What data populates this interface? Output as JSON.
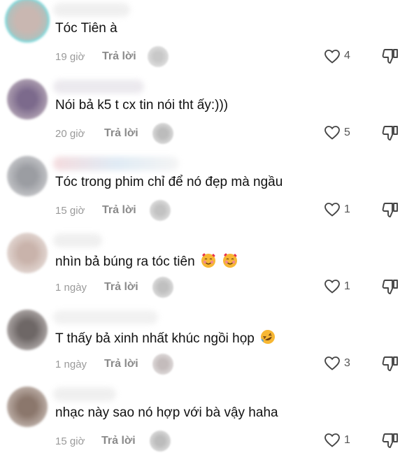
{
  "reply_label": "Trả lời",
  "comments": [
    {
      "text": "Tóc Tiên à",
      "time": "19 giờ",
      "likes": "4",
      "emojis": []
    },
    {
      "text": "Nói bả k5 t cx tin nói tht ấy:)))",
      "time": "20 giờ",
      "likes": "5",
      "emojis": []
    },
    {
      "text": "Tóc trong phim chỉ để nó đẹp mà ngầu",
      "time": "15 giờ",
      "likes": "1",
      "emojis": []
    },
    {
      "text": "nhìn bả búng ra tóc tiên",
      "time": "1 ngày",
      "likes": "1",
      "emojis": [
        "smiling-face-with-hearts",
        "smiling-face-with-hearts"
      ]
    },
    {
      "text": "T thấy bả xinh nhất khúc ngồi họp",
      "time": "1 ngày",
      "likes": "3",
      "emojis": [
        "rolling-on-floor-laughing"
      ]
    },
    {
      "text": "nhạc này sao nó hợp với bà vậy haha",
      "time": "15 giờ",
      "likes": "1",
      "emojis": []
    }
  ],
  "colors": {
    "text": "#111111",
    "meta": "#9a9a9a",
    "reply": "#8a8a8a",
    "icon": "#444444"
  }
}
